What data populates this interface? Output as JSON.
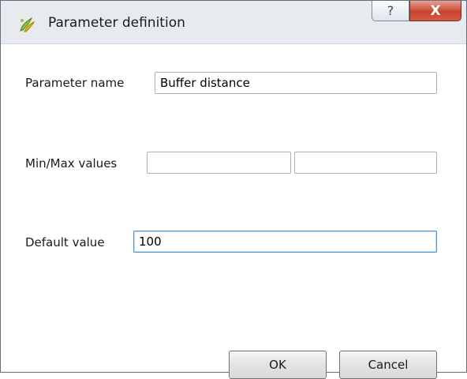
{
  "window": {
    "title": "Parameter definition",
    "help_label": "?",
    "close_label": "X"
  },
  "form": {
    "parameter_name": {
      "label": "Parameter name",
      "value": "Buffer distance"
    },
    "min_max": {
      "label": "Min/Max values",
      "min_value": "",
      "max_value": ""
    },
    "default_value": {
      "label": "Default value",
      "value": "100"
    }
  },
  "buttons": {
    "ok_label": "OK",
    "cancel_label": "Cancel"
  }
}
